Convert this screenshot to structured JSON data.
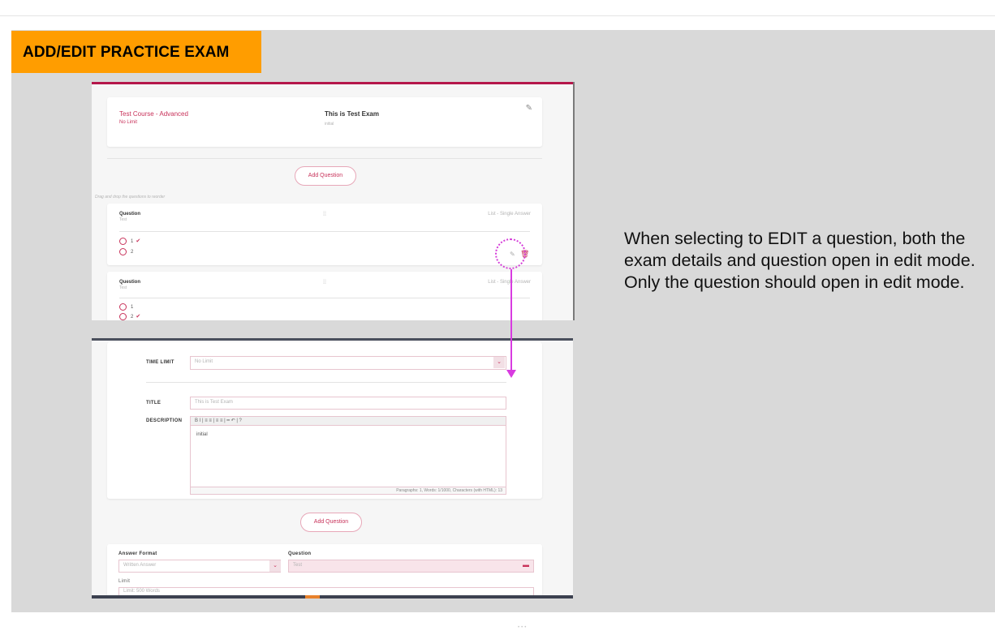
{
  "slide": {
    "title": "ADD/EDIT PRACTICE EXAM",
    "caption": "When selecting to EDIT a question, both the exam details and question open in edit mode. Only the question should open in edit mode."
  },
  "shot1": {
    "course_name": "Test Course - Advanced",
    "time_limit_value": "No Limit",
    "exam_title": "This is Test Exam",
    "exam_description": "initial",
    "add_question_label": "Add Question",
    "drag_hint": "Drag and drop the questions to reorder",
    "questions": [
      {
        "label": "Question",
        "text": "Test",
        "format": "List - Single Answer",
        "options": [
          {
            "text": "1",
            "correct": true
          },
          {
            "text": "2",
            "correct": false
          }
        ]
      },
      {
        "label": "Question",
        "text": "Test",
        "format": "List - Single Answer",
        "options": [
          {
            "text": "1",
            "correct": false
          },
          {
            "text": "2",
            "correct": true
          }
        ]
      }
    ]
  },
  "shot2": {
    "time_limit_label": "TIME LIMIT",
    "time_limit_value": "No Limit",
    "title_label": "TITLE",
    "title_value": "This is Test Exam",
    "description_label": "DESCRIPTION",
    "toolbar_text": "B  I  |  ≡  ≡  |  ≡  ≡  |  ━  ↶  |  ?",
    "description_value": "initial",
    "editor_status": "Paragraphs: 1, Words: 1/1000, Characters (with HTML): 13",
    "add_question_label": "Add Question",
    "answer_format_label": "Answer Format",
    "answer_format_value": "Written Answer",
    "question_label": "Question",
    "question_value": "Test",
    "limit_label": "Limit",
    "limit_value": "Limit: 500 Words"
  },
  "colors": {
    "accent": "#c8325a",
    "title_tag": "#ff9d00",
    "annotation": "#d83be0",
    "slide_bg": "#d9d9d9"
  },
  "icons": {
    "edit": "pencil-icon",
    "delete": "trash-icon",
    "drag": "drag-handle-icon",
    "dropdown": "chevron-down-icon"
  }
}
